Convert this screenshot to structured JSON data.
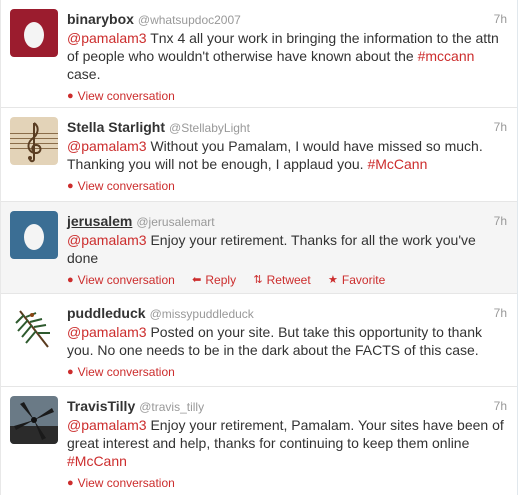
{
  "tweets": [
    {
      "fullname": "binarybox",
      "username": "@whatsupdoc2007",
      "time": "7h",
      "mention": "@pamalam3",
      "text_before": " Tnx 4 all your work in bringing the information to the attn of people who wouldn't otherwise have known about the ",
      "hashtag": "#mccann",
      "text_after": " case.",
      "view": "View conversation",
      "avatar": "egg-avatar",
      "avatar_color": "#9b1c2e"
    },
    {
      "fullname": "Stella Starlight",
      "username": "@StellabyLight",
      "time": "7h",
      "mention": "@pamalam3",
      "text_before": " Without you Pamalam, I would have missed so much. Thanking you will not be enough, I applaud you. ",
      "hashtag": "#McCann",
      "text_after": "",
      "view": "View conversation",
      "avatar": "treble-clef-avatar",
      "avatar_color": "#d8c2a0"
    },
    {
      "fullname": "jerusalem",
      "username": "@jerusalemart",
      "time": "7h",
      "mention": "@pamalam3",
      "text_before": " Enjoy your retirement. Thanks for all the work you've done",
      "hashtag": "",
      "text_after": "",
      "view": "View conversation",
      "reply": "Reply",
      "retweet": "Retweet",
      "favorite": "Favorite",
      "avatar": "egg-avatar",
      "avatar_color": "#3b6e94"
    },
    {
      "fullname": "puddleduck",
      "username": "@missypuddleduck",
      "time": "7h",
      "mention": "@pamalam3",
      "text_before": " Posted on your site. But take this opportunity to thank you. No one needs to be in the dark about the FACTS of this case.",
      "hashtag": "",
      "text_after": "",
      "view": "View conversation",
      "avatar": "pine-branch-avatar",
      "avatar_color": "#ffffff"
    },
    {
      "fullname": "TravisTilly",
      "username": "@travis_tilly",
      "time": "7h",
      "mention": "@pamalam3",
      "text_before": " Enjoy your retirement, Pamalam. Your sites have been of great interest and help, thanks for continuing to keep them online ",
      "hashtag": "#McCann",
      "text_after": "",
      "view": "View conversation",
      "avatar": "windmill-avatar",
      "avatar_color": "#2b2b2b"
    }
  ],
  "colors": {
    "accent": "#cc2d2d",
    "muted": "#999999",
    "text": "#333333",
    "hover_bg": "#f5f5f5"
  }
}
